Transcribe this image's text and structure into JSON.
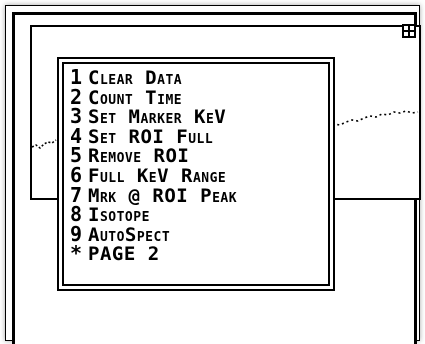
{
  "menu": {
    "items": [
      {
        "key": "1",
        "label": "Clear Data"
      },
      {
        "key": "2",
        "label": "Count Time"
      },
      {
        "key": "3",
        "label": "Set Marker KeV"
      },
      {
        "key": "4",
        "label": "Set ROI Full"
      },
      {
        "key": "5",
        "label": "Remove ROI"
      },
      {
        "key": "6",
        "label": "Full KeV Range"
      },
      {
        "key": "7",
        "label": "Mrk @ ROI Peak"
      },
      {
        "key": "8",
        "label": "Isotope"
      },
      {
        "key": "9",
        "label": "AutoSpect"
      },
      {
        "key": "*",
        "label": "PAGE 2"
      }
    ]
  },
  "icons": {
    "corner": "grid-box-icon"
  },
  "colors": {
    "foreground": "#000000",
    "background": "#ffffff"
  }
}
